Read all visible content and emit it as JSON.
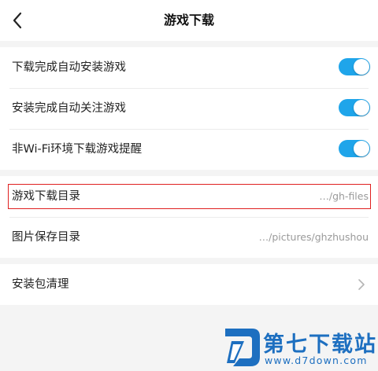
{
  "header": {
    "title": "游戏下载",
    "back_icon": "chevron-left-icon"
  },
  "settings": {
    "toggles": [
      {
        "label": "下载完成自动安装游戏",
        "on": true
      },
      {
        "label": "安装完成自动关注游戏",
        "on": true
      },
      {
        "label": "非Wi-Fi环境下载游戏提醒",
        "on": true
      }
    ],
    "directories": [
      {
        "label": "游戏下载目录",
        "value": "…/gh-files",
        "highlighted": true
      },
      {
        "label": "图片保存目录",
        "value": "…/pictures/ghzhushou",
        "highlighted": false
      }
    ],
    "cleanup": {
      "label": "安装包清理",
      "icon": "chevron-right-icon"
    }
  },
  "watermark": {
    "name": "第七下载站",
    "url": "www.d7down.com"
  },
  "colors": {
    "toggle_on": "#1fa5ea",
    "highlight_border": "#e02020",
    "watermark": "#1d6fc0",
    "background": "#f4f4f4"
  }
}
